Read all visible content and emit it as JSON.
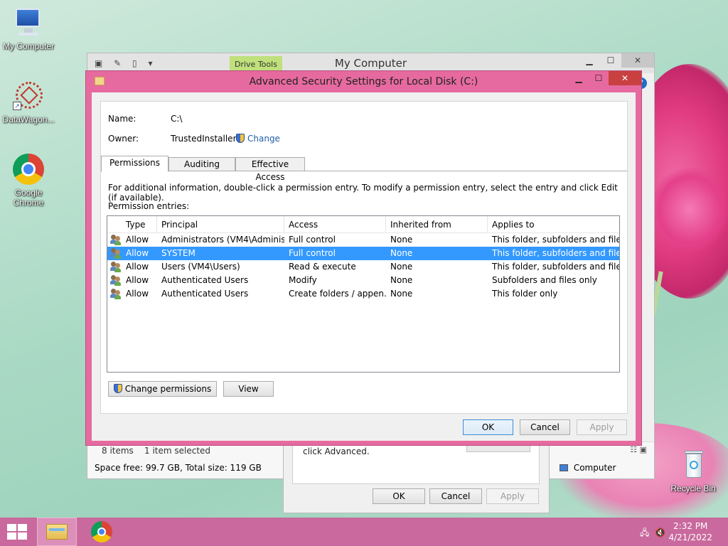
{
  "desktop": {
    "icons": [
      {
        "label": "My Computer",
        "icon": "computer-icon"
      },
      {
        "label": "DataWagon...",
        "icon": "datawagon-icon"
      },
      {
        "label": "Google Chrome",
        "icon": "chrome-icon"
      },
      {
        "label": "Recycle Bin",
        "icon": "recycle-bin-icon"
      }
    ]
  },
  "explorer": {
    "title": "My Computer",
    "ribbon_context_tab": "Drive Tools",
    "status": {
      "items": "8 items",
      "selected": "1 item selected",
      "space": "Space free: 99.7 GB, Total size: 119 GB",
      "location": "Computer"
    }
  },
  "properties_dialog": {
    "text": "click Advanced.",
    "ok": "OK",
    "cancel": "Cancel",
    "apply": "Apply"
  },
  "advanced_security": {
    "title": "Advanced Security Settings for Local Disk (C:)",
    "name_label": "Name:",
    "name_value": "C:\\",
    "owner_label": "Owner:",
    "owner_value": "TrustedInstaller",
    "change_link": "Change",
    "tabs": [
      "Permissions",
      "Auditing",
      "Effective Access"
    ],
    "active_tab": "Permissions",
    "info_text": "For additional information, double-click a permission entry. To modify a permission entry, select the entry and click Edit (if available).",
    "entries_label": "Permission entries:",
    "columns": [
      "Type",
      "Principal",
      "Access",
      "Inherited from",
      "Applies to"
    ],
    "rows": [
      {
        "type": "Allow",
        "principal": "Administrators (VM4\\Adminis...",
        "access": "Full control",
        "inherited": "None",
        "applies": "This folder, subfolders and files"
      },
      {
        "type": "Allow",
        "principal": "SYSTEM",
        "access": "Full control",
        "inherited": "None",
        "applies": "This folder, subfolders and files"
      },
      {
        "type": "Allow",
        "principal": "Users (VM4\\Users)",
        "access": "Read & execute",
        "inherited": "None",
        "applies": "This folder, subfolders and files"
      },
      {
        "type": "Allow",
        "principal": "Authenticated Users",
        "access": "Modify",
        "inherited": "None",
        "applies": "Subfolders and files only"
      },
      {
        "type": "Allow",
        "principal": "Authenticated Users",
        "access": "Create folders / appen...",
        "inherited": "None",
        "applies": "This folder only"
      }
    ],
    "selected_row": 1,
    "change_permissions": "Change permissions",
    "view": "View",
    "ok": "OK",
    "cancel": "Cancel",
    "apply": "Apply"
  },
  "taskbar": {
    "time": "2:32 PM",
    "date": "4/21/2022"
  },
  "colors": {
    "dialog_frame": "#e66a9f",
    "taskbar": "#c9699d",
    "selection": "#3399ff",
    "link": "#1e5fa8"
  }
}
